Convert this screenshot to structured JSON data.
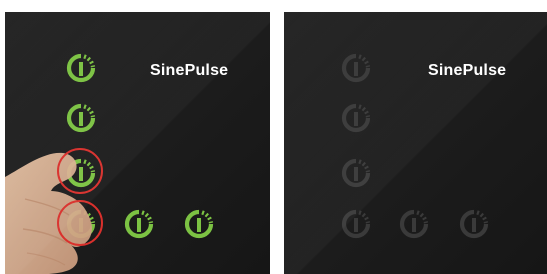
{
  "left_panel": {
    "title": "SinePulse",
    "state": "active",
    "button_color": "#7cc243"
  },
  "right_panel": {
    "title": "SinePulse",
    "state": "inactive",
    "button_color": "#3a3a3a"
  },
  "icons": {
    "power_button": "power-icon",
    "touch_indicator": "red-circle",
    "finger": "hand-pointer"
  },
  "colors": {
    "background": "#1e1e1e",
    "active_green": "#7cc243",
    "inactive_gray": "#3a3a3a",
    "touch_red": "#d9302c"
  }
}
